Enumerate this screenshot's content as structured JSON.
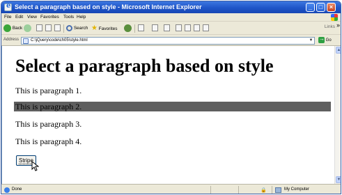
{
  "window": {
    "title": "Select a paragraph based on style - Microsoft Internet Explorer",
    "buttons": {
      "minimize": "_",
      "maximize": "□",
      "close": "×"
    }
  },
  "menubar": {
    "items": [
      "File",
      "Edit",
      "View",
      "Favorites",
      "Tools",
      "Help"
    ]
  },
  "toolbar": {
    "back": "Back",
    "search": "Search",
    "favorites": "Favorites",
    "links": "Links"
  },
  "address": {
    "label": "Address",
    "value": "C:\\jQuery\\code\\ch05\\style.html",
    "go": "Go"
  },
  "page": {
    "heading": "Select a paragraph based on style",
    "paragraphs": [
      "This is paragraph 1.",
      "This is paragraph 2.",
      "This is paragraph 3.",
      "This is paragraph 4."
    ],
    "highlighted_paragraph": 2,
    "highlight_color": "#5f5f5f",
    "button_label": "Stripe"
  },
  "statusbar": {
    "status": "Done",
    "zone": "My Computer"
  },
  "colors": {
    "titlebar": "#1f55c8",
    "chrome": "#ece9d8",
    "content_bg": "#ffffff"
  }
}
